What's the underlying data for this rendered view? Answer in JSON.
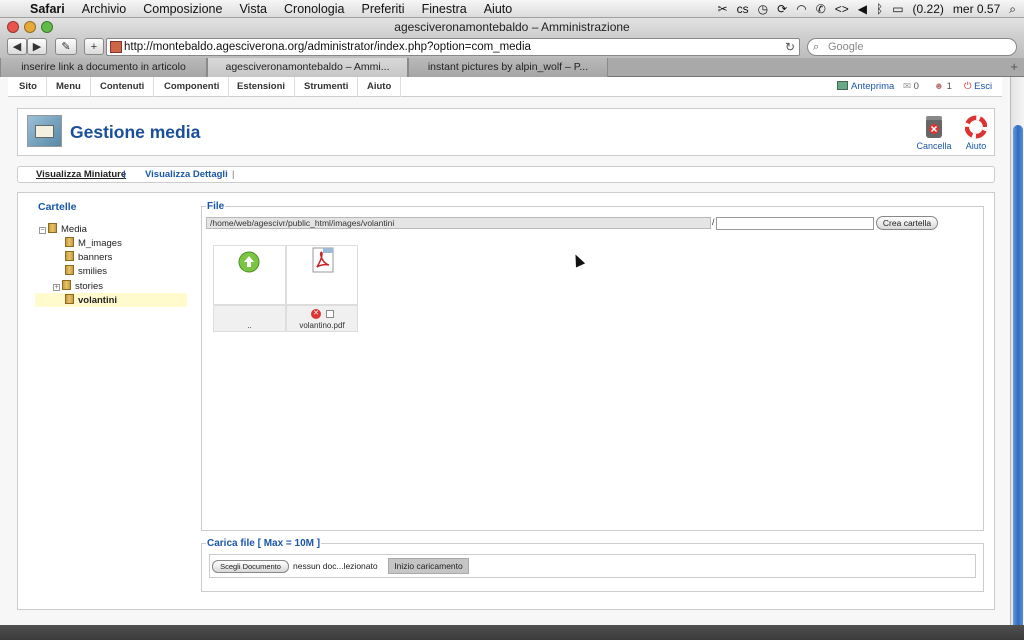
{
  "menubar": {
    "app": "Safari",
    "items": [
      "Archivio",
      "Composizione",
      "Vista",
      "Cronologia",
      "Preferiti",
      "Finestra",
      "Aiuto"
    ],
    "battery": "(0.22)",
    "clock": "mer 0.57"
  },
  "window": {
    "title": "agesciveronamontebaldo – Amministrazione"
  },
  "browser": {
    "url": "http://montebaldo.agesciverona.org/administrator/index.php?option=com_media",
    "search_placeholder": "Google",
    "tabs": [
      {
        "label": "inserire link a documento in articolo",
        "active": false
      },
      {
        "label": "agesciveronamontebaldo – Ammi...",
        "active": true
      },
      {
        "label": "instant pictures by alpin_wolf – P...",
        "active": false
      }
    ]
  },
  "joomla_menu": {
    "items": [
      "Sito",
      "Menu",
      "Contenuti",
      "Componenti",
      "Estensioni",
      "Strumenti",
      "Aiuto"
    ],
    "preview": "Anteprima",
    "messages_count": "0",
    "users_count": "1",
    "logout": "Esci"
  },
  "header": {
    "title": "Gestione media",
    "delete_label": "Cancella",
    "help_label": "Aiuto"
  },
  "submenu": {
    "thumbnails": "Visualizza Miniature",
    "details": "Visualizza Dettagli"
  },
  "folders": {
    "title": "Cartelle",
    "root": "Media",
    "items": [
      "M_images",
      "banners",
      "smilies",
      "stories",
      "volantini"
    ],
    "selected": "volantini"
  },
  "files": {
    "legend": "File",
    "path": "/home/web/agescivr/public_html/images/volantini",
    "separator": "/",
    "new_folder_value": "",
    "create_folder_button": "Crea cartella",
    "items": [
      {
        "name": "..",
        "icon": "folder-up-icon"
      },
      {
        "name": "volantino.pdf",
        "icon": "pdf-icon"
      }
    ]
  },
  "upload": {
    "legend": "Carica file [ Max = 10M ]",
    "choose_button": "Scegli Documento",
    "no_file": "nessun doc...lezionato",
    "start_button": "Inizio caricamento"
  },
  "colors": {
    "accent": "#1a57a8",
    "selection": "#fffbcc"
  }
}
